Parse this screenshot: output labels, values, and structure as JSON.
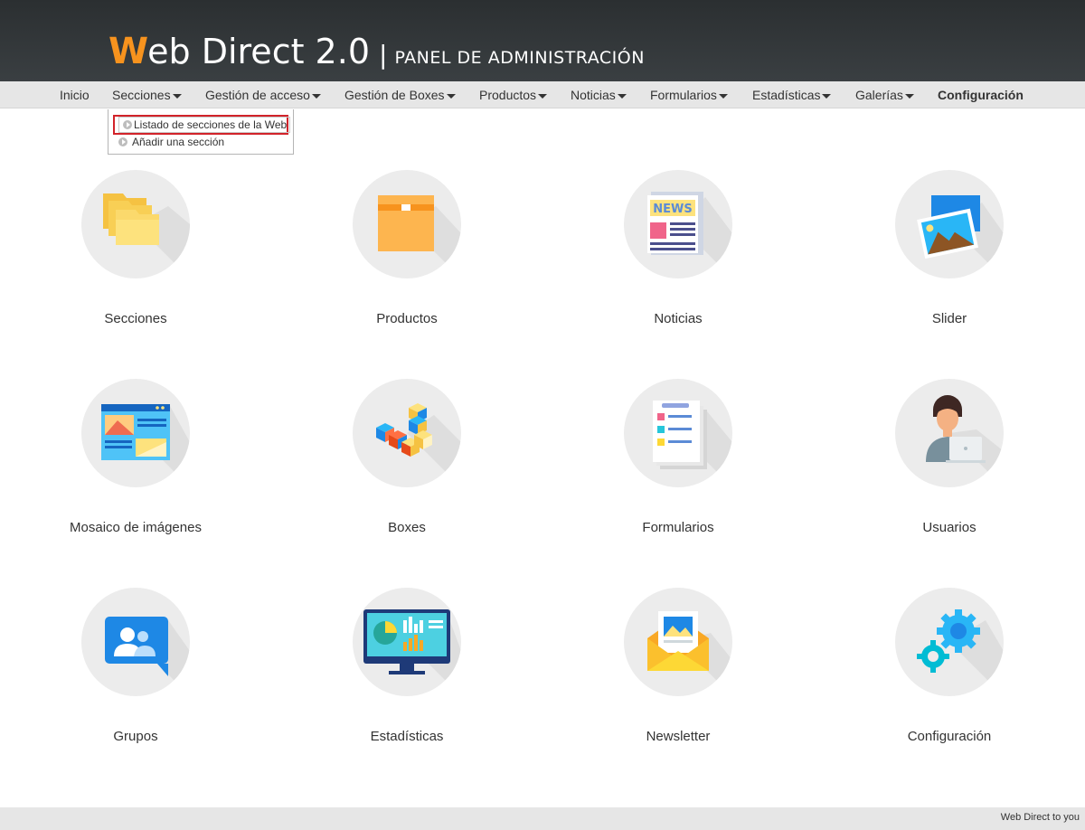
{
  "header": {
    "brand_initial": "W",
    "brand_rest": "eb Direct 2.0",
    "separator": "|",
    "subtitle": "PANEL DE ADMINISTRACIÓN"
  },
  "nav": {
    "items": [
      {
        "label": "Inicio",
        "has_caret": false
      },
      {
        "label": "Secciones",
        "has_caret": true
      },
      {
        "label": "Gestión de acceso",
        "has_caret": true
      },
      {
        "label": "Gestión de Boxes",
        "has_caret": true
      },
      {
        "label": "Productos",
        "has_caret": true
      },
      {
        "label": "Noticias",
        "has_caret": true
      },
      {
        "label": "Formularios",
        "has_caret": true
      },
      {
        "label": "Estadísticas",
        "has_caret": true
      },
      {
        "label": "Galerías",
        "has_caret": true
      },
      {
        "label": "Configuración",
        "has_caret": false,
        "bold": true
      }
    ]
  },
  "dropdown": {
    "items": [
      {
        "label": "Listado de secciones de la Web",
        "selected": true
      },
      {
        "label": "Añadir una sección",
        "selected": false
      }
    ]
  },
  "tiles": [
    {
      "label": "Secciones",
      "icon": "folders-icon"
    },
    {
      "label": "Productos",
      "icon": "box-icon"
    },
    {
      "label": "Noticias",
      "icon": "newspaper-icon"
    },
    {
      "label": "Slider",
      "icon": "photos-icon"
    },
    {
      "label": "Mosaico de imágenes",
      "icon": "image-mosaic-icon"
    },
    {
      "label": "Boxes",
      "icon": "cubes-icon"
    },
    {
      "label": "Formularios",
      "icon": "forms-icon"
    },
    {
      "label": "Usuarios",
      "icon": "user-laptop-icon"
    },
    {
      "label": "Grupos",
      "icon": "group-chat-icon"
    },
    {
      "label": "Estadísticas",
      "icon": "stats-monitor-icon"
    },
    {
      "label": "Newsletter",
      "icon": "envelope-icon"
    },
    {
      "label": "Configuración",
      "icon": "gears-icon"
    }
  ],
  "footer": {
    "text": "Web Direct to you"
  },
  "colors": {
    "header_bg": "#2b2f31",
    "brand_accent": "#f7931e",
    "nav_bg": "#e6e6e6",
    "selected_border": "#d2232a",
    "circle_bg": "#ececec"
  }
}
